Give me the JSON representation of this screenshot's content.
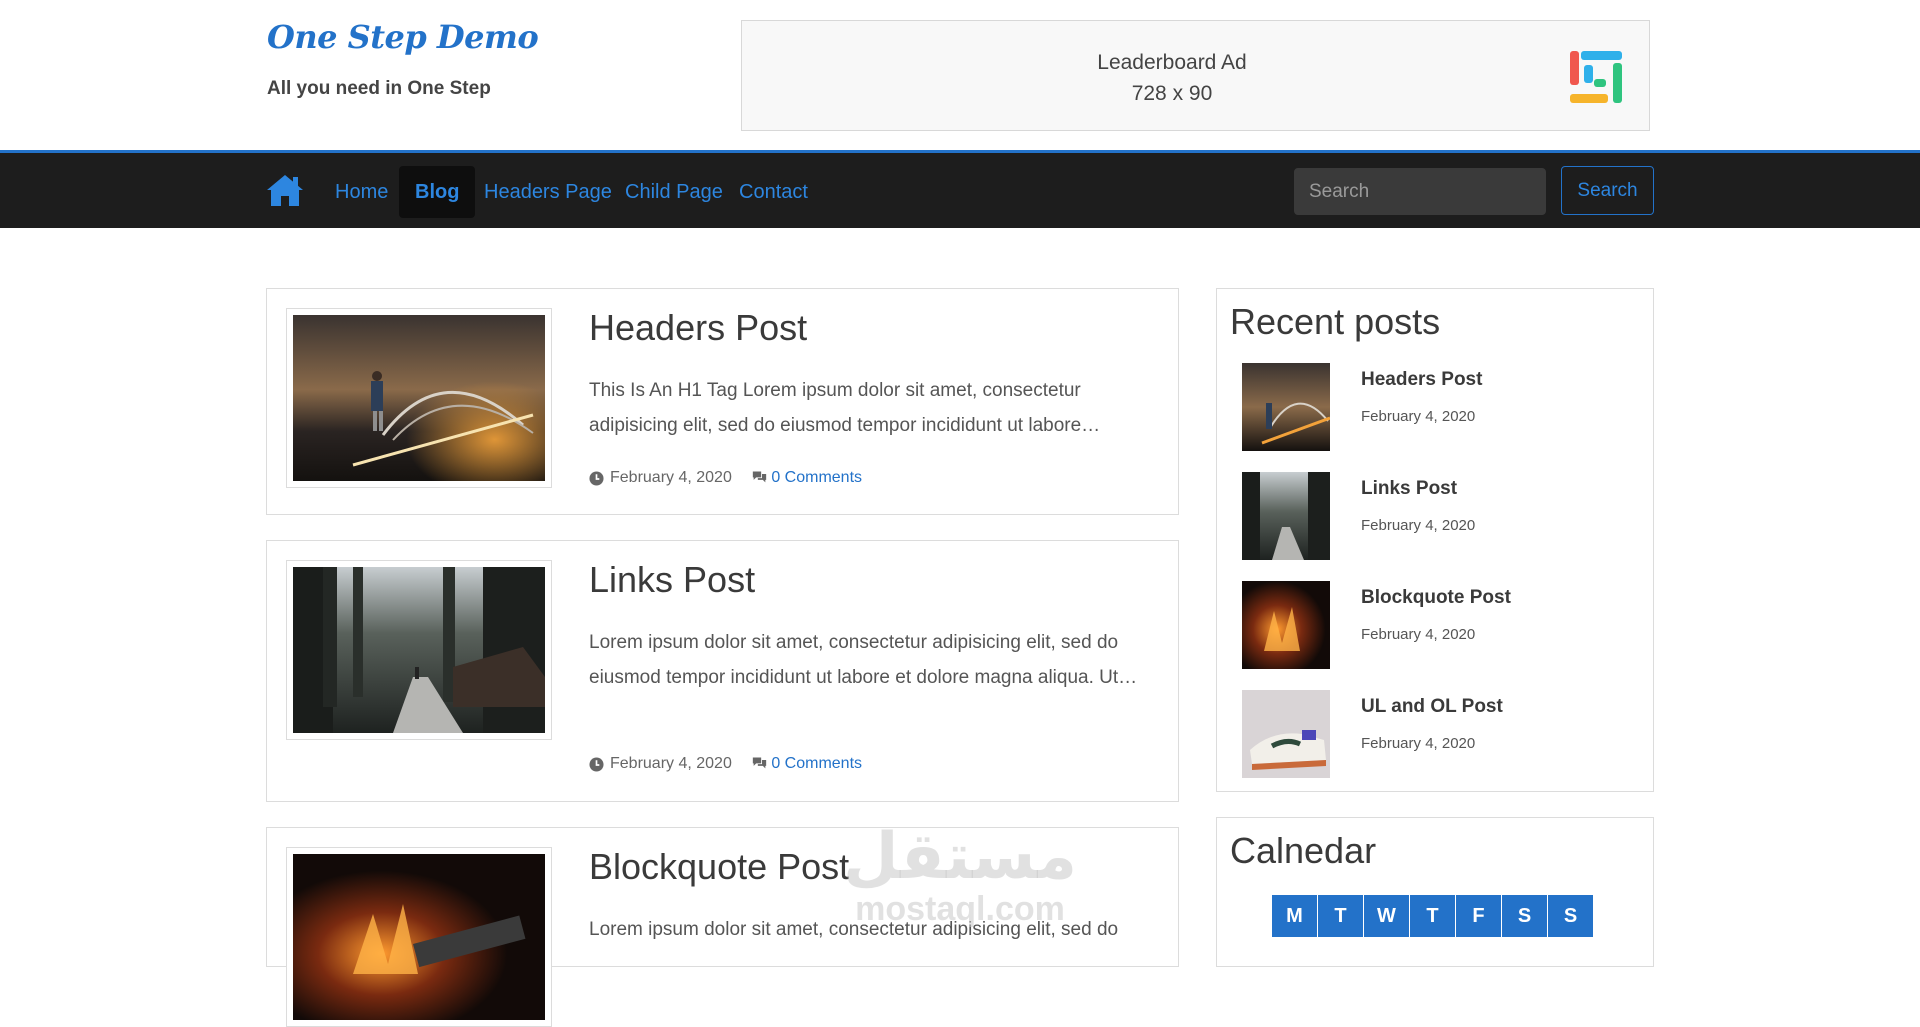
{
  "header": {
    "site_title": "One Step Demo",
    "tagline": "All you need in One Step",
    "ad": {
      "line1": "Leaderboard Ad",
      "line2": "728 x 90"
    }
  },
  "nav": {
    "home_icon": "home-icon",
    "items": [
      {
        "label": "Home",
        "active": false
      },
      {
        "label": "Blog",
        "active": true
      },
      {
        "label": "Headers Page",
        "active": false
      },
      {
        "label": "Child Page",
        "active": false
      },
      {
        "label": "Contact",
        "active": false
      }
    ],
    "search": {
      "placeholder": "Search",
      "button_label": "Search"
    }
  },
  "posts": [
    {
      "title": "Headers Post",
      "excerpt": "This Is An H1 Tag Lorem ipsum dolor sit amet, consectetur adipisicing elit, sed do eiusmod tempor incididunt ut labore…",
      "date": "February 4, 2020",
      "comments": "0 Comments"
    },
    {
      "title": "Links Post",
      "excerpt": "Lorem ipsum dolor sit amet, consectetur adipisicing elit, sed do eiusmod tempor incididunt ut labore et dolore magna aliqua. Ut…",
      "date": "February 4, 2020",
      "comments": "0 Comments"
    },
    {
      "title": "Blockquote Post",
      "excerpt": "Lorem ipsum dolor sit amet, consectetur adipisicing elit, sed do",
      "date": "",
      "comments": ""
    }
  ],
  "sidebar": {
    "recent": {
      "title": "Recent posts",
      "items": [
        {
          "title": "Headers Post",
          "date": "February 4, 2020"
        },
        {
          "title": "Links Post",
          "date": "February 4, 2020"
        },
        {
          "title": "Blockquote Post",
          "date": "February 4, 2020"
        },
        {
          "title": "UL and OL Post",
          "date": "February 4, 2020"
        }
      ]
    },
    "calendar": {
      "title": "Calnedar",
      "days": [
        "M",
        "T",
        "W",
        "T",
        "F",
        "S",
        "S"
      ]
    }
  },
  "watermark": {
    "arabic": "مستقل",
    "latin": "mostaql.com"
  },
  "colors": {
    "accent": "#2372c9",
    "navbar_bg": "#1d1d1d"
  }
}
